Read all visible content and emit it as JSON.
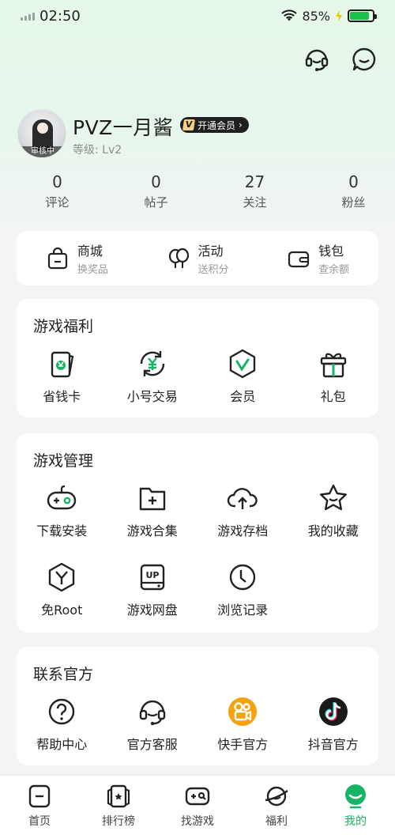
{
  "status_bar": {
    "time": "02:50",
    "battery_percent": "85%",
    "battery_level": 0.85
  },
  "top_icons": [
    "headset-icon",
    "chat-icon"
  ],
  "profile": {
    "username": "PVZ一月酱",
    "vip_badge": "开通会员",
    "vip_badge_chevron": "›",
    "level": "等级: Lv2",
    "avatar_status": "审核中"
  },
  "stats": [
    {
      "value": "0",
      "label": "评论"
    },
    {
      "value": "0",
      "label": "帖子"
    },
    {
      "value": "27",
      "label": "关注"
    },
    {
      "value": "0",
      "label": "粉丝"
    }
  ],
  "quick_links": [
    {
      "title": "商城",
      "sub": "换奖品",
      "icon": "shop-bag-icon"
    },
    {
      "title": "活动",
      "sub": "送积分",
      "icon": "balloon-icon"
    },
    {
      "title": "钱包",
      "sub": "查余额",
      "icon": "wallet-icon"
    }
  ],
  "welfare": {
    "title": "游戏福利",
    "items": [
      {
        "label": "省钱卡",
        "icon": "save-card-icon"
      },
      {
        "label": "小号交易",
        "icon": "yen-exchange-icon"
      },
      {
        "label": "会员",
        "icon": "vip-hexagon-icon"
      },
      {
        "label": "礼包",
        "icon": "gift-icon"
      }
    ]
  },
  "manage": {
    "title": "游戏管理",
    "items": [
      {
        "label": "下载安装",
        "icon": "gamepad-icon"
      },
      {
        "label": "游戏合集",
        "icon": "folder-add-icon"
      },
      {
        "label": "游戏存档",
        "icon": "cloud-upload-icon"
      },
      {
        "label": "我的收藏",
        "icon": "star-icon"
      },
      {
        "label": "免Root",
        "icon": "y-hexagon-icon"
      },
      {
        "label": "游戏网盘",
        "icon": "up-disk-icon"
      },
      {
        "label": "浏览记录",
        "icon": "clock-icon"
      }
    ]
  },
  "contact": {
    "title": "联系官方",
    "items": [
      {
        "label": "帮助中心",
        "icon": "help-icon"
      },
      {
        "label": "官方客服",
        "icon": "headset-icon"
      },
      {
        "label": "快手官方",
        "icon": "kuaishou-icon"
      },
      {
        "label": "抖音官方",
        "icon": "douyin-icon"
      }
    ]
  },
  "tabs": [
    {
      "label": "首页",
      "icon": "home-icon"
    },
    {
      "label": "排行榜",
      "icon": "ranking-icon"
    },
    {
      "label": "找游戏",
      "icon": "find-game-icon"
    },
    {
      "label": "福利",
      "icon": "planet-icon"
    },
    {
      "label": "我的",
      "icon": "profile-icon",
      "active": true
    }
  ],
  "colors": {
    "accent": "#19b368",
    "kuaishou": "#f5a20c",
    "douyin": "#1a1a1a"
  }
}
